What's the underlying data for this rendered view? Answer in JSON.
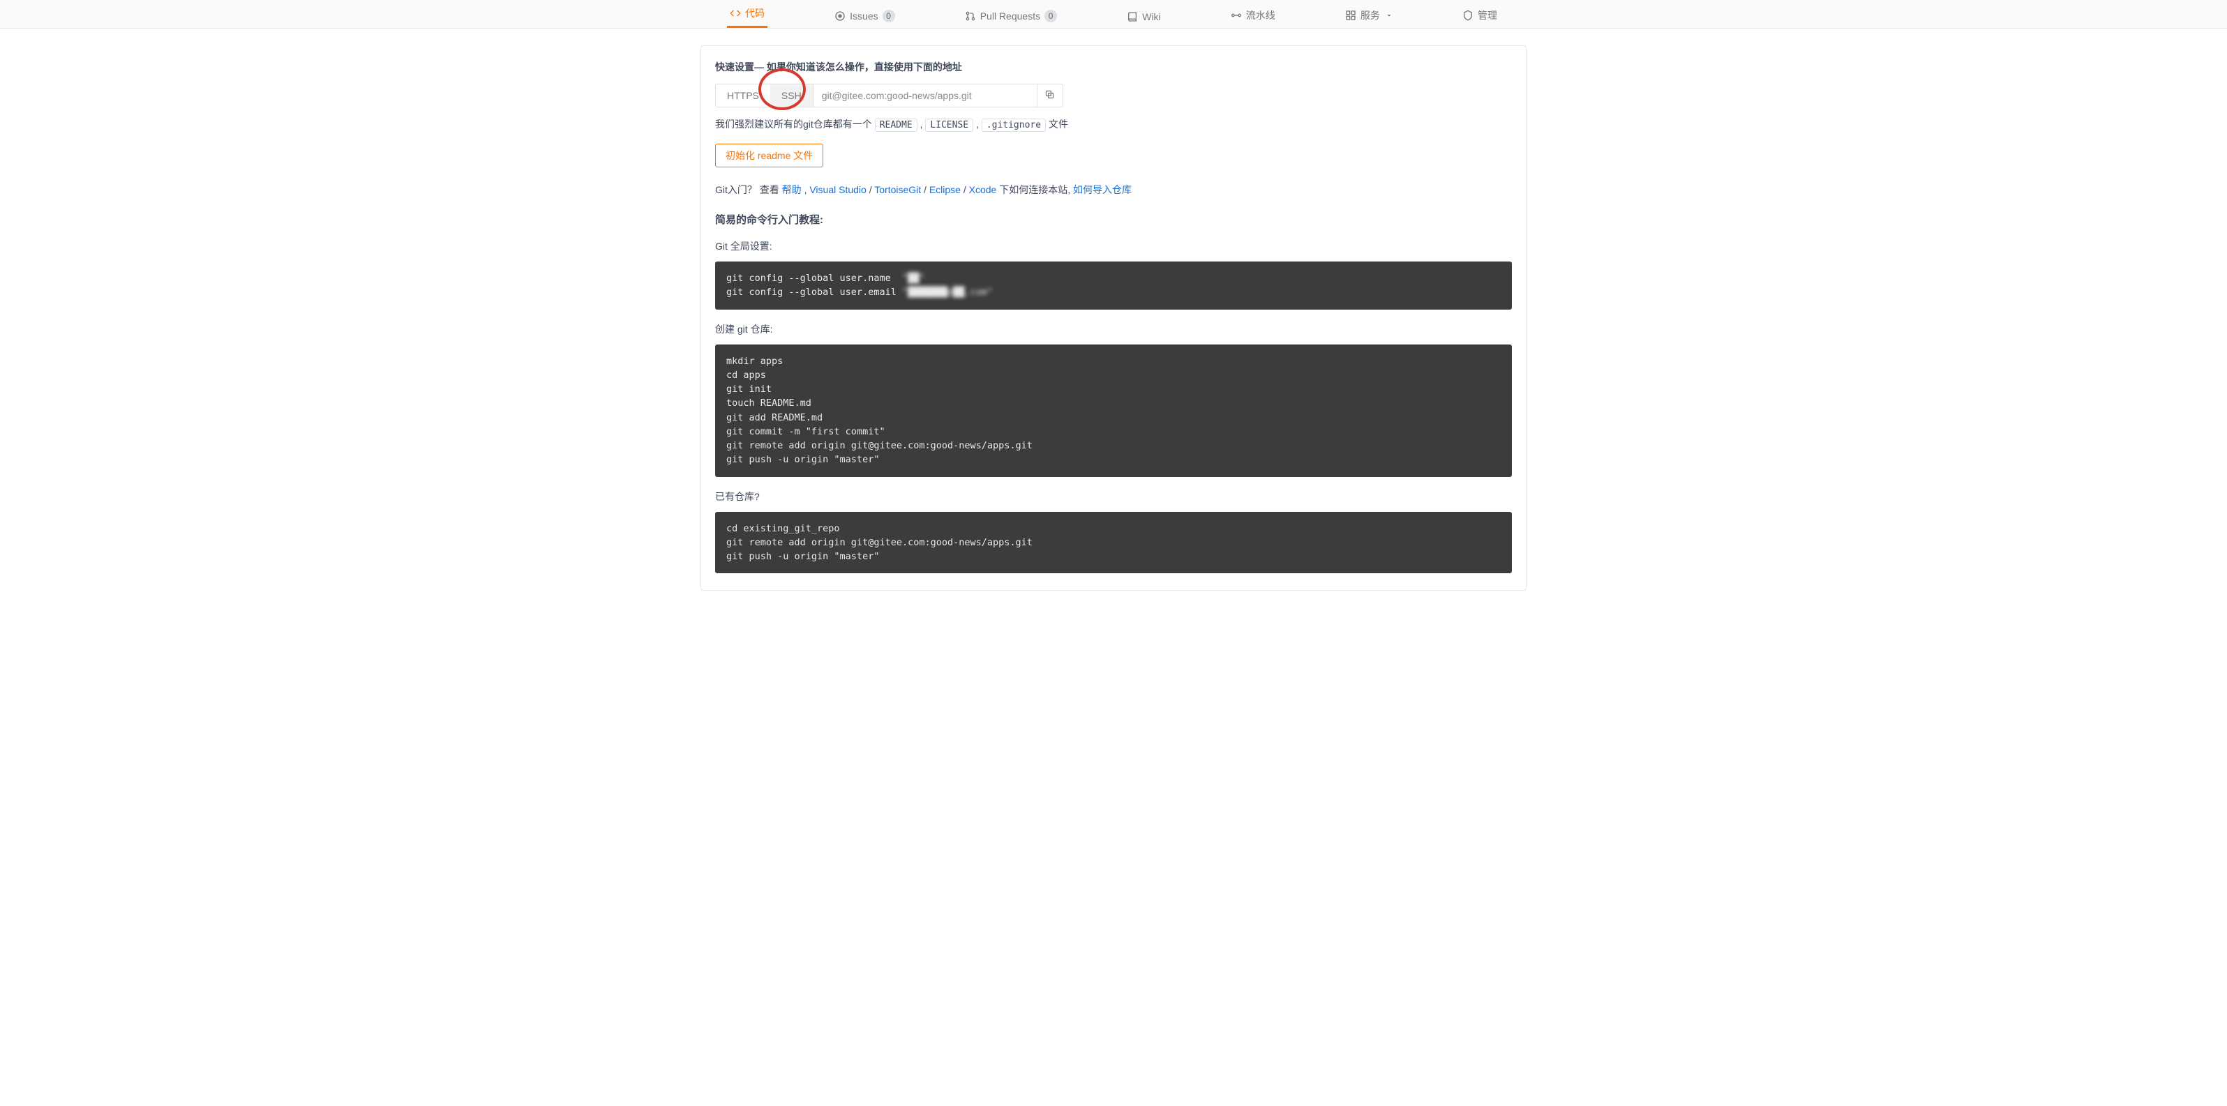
{
  "nav": {
    "code": "代码",
    "issues": "Issues",
    "issues_count": "0",
    "pr": "Pull Requests",
    "pr_count": "0",
    "wiki": "Wiki",
    "pipeline": "流水线",
    "services": "服务",
    "manage": "管理"
  },
  "setup": {
    "title": "快速设置— 如果你知道该怎么操作，直接使用下面的地址",
    "https_label": "HTTPS",
    "ssh_label": "SSH",
    "clone_url": "git@gitee.com:good-news/apps.git",
    "recommend_prefix": "我们强烈建议所有的git仓库都有一个 ",
    "readme": "README",
    "sep1": " , ",
    "license": "LICENSE",
    "sep2": " , ",
    "gitignore": ".gitignore",
    "recommend_suffix": " 文件",
    "init_readme": "初始化 readme 文件"
  },
  "intro": {
    "prefix": "Git入门？ 查看 ",
    "help": "帮助",
    "sep1": " , ",
    "vs": "Visual Studio",
    "sep_slash": " / ",
    "tortoise": "TortoiseGit",
    "eclipse": "Eclipse",
    "xcode": "Xcode",
    "mid": " 下如何连接本站, ",
    "import": "如何导入仓库"
  },
  "tutorial": {
    "title": "简易的命令行入门教程:",
    "global_title": "Git 全局设置:",
    "global_code_prefix": "git config --global user.name  ",
    "global_code_name": "\"██\"",
    "global_code_mid": "\ngit config --global user.email ",
    "global_code_email": "\"███████@██.com\"",
    "create_title": "创建 git 仓库:",
    "create_code": "mkdir apps\ncd apps\ngit init\ntouch README.md\ngit add README.md\ngit commit -m \"first commit\"\ngit remote add origin git@gitee.com:good-news/apps.git\ngit push -u origin \"master\"",
    "existing_title": "已有仓库?",
    "existing_code": "cd existing_git_repo\ngit remote add origin git@gitee.com:good-news/apps.git\ngit push -u origin \"master\""
  }
}
